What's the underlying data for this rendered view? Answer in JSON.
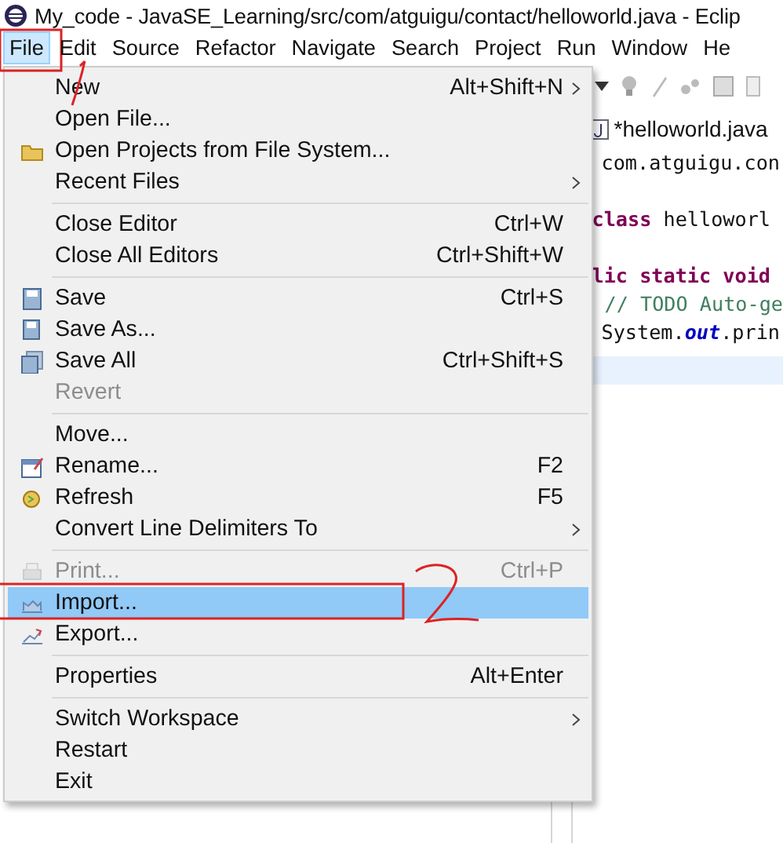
{
  "window": {
    "title": "My_code - JavaSE_Learning/src/com/atguigu/contact/helloworld.java - Eclip"
  },
  "menu_bar": [
    {
      "label": "File",
      "selected": true,
      "annotated": true
    },
    {
      "label": "Edit",
      "selected": false,
      "annotated": false
    },
    {
      "label": "Source",
      "selected": false,
      "annotated": false
    },
    {
      "label": "Refactor",
      "selected": false,
      "annotated": false
    },
    {
      "label": "Navigate",
      "selected": false,
      "annotated": false
    },
    {
      "label": "Search",
      "selected": false,
      "annotated": false
    },
    {
      "label": "Project",
      "selected": false,
      "annotated": false
    },
    {
      "label": "Run",
      "selected": false,
      "annotated": false
    },
    {
      "label": "Window",
      "selected": false,
      "annotated": false
    },
    {
      "label": "He",
      "selected": false,
      "annotated": false
    }
  ],
  "file_menu": [
    {
      "kind": "item",
      "label": "New",
      "shortcut": "Alt+Shift+N",
      "submenu": true,
      "disabled": false,
      "selected": false,
      "annotated": false
    },
    {
      "kind": "item",
      "label": "Open File...",
      "disabled": false,
      "selected": false,
      "annotated": false
    },
    {
      "kind": "item",
      "label": "Open Projects from File System...",
      "disabled": false,
      "selected": false,
      "annotated": false
    },
    {
      "kind": "item",
      "label": "Recent Files",
      "submenu": true,
      "disabled": false,
      "selected": false,
      "annotated": false
    },
    {
      "kind": "separator"
    },
    {
      "kind": "item",
      "label": "Close Editor",
      "shortcut": "Ctrl+W",
      "disabled": false,
      "selected": false,
      "annotated": false
    },
    {
      "kind": "item",
      "label": "Close All Editors",
      "shortcut": "Ctrl+Shift+W",
      "disabled": false,
      "selected": false,
      "annotated": false
    },
    {
      "kind": "separator"
    },
    {
      "kind": "item",
      "label": "Save",
      "shortcut": "Ctrl+S",
      "disabled": false,
      "selected": false,
      "annotated": false
    },
    {
      "kind": "item",
      "label": "Save As...",
      "disabled": false,
      "selected": false,
      "annotated": false
    },
    {
      "kind": "item",
      "label": "Save All",
      "shortcut": "Ctrl+Shift+S",
      "disabled": false,
      "selected": false,
      "annotated": false
    },
    {
      "kind": "item",
      "label": "Revert",
      "disabled": true,
      "selected": false,
      "annotated": false
    },
    {
      "kind": "separator"
    },
    {
      "kind": "item",
      "label": "Move...",
      "disabled": false,
      "selected": false,
      "annotated": false
    },
    {
      "kind": "item",
      "label": "Rename...",
      "shortcut": "F2",
      "disabled": false,
      "selected": false,
      "annotated": false
    },
    {
      "kind": "item",
      "label": "Refresh",
      "shortcut": "F5",
      "disabled": false,
      "selected": false,
      "annotated": false
    },
    {
      "kind": "item",
      "label": "Convert Line Delimiters To",
      "submenu": true,
      "disabled": false,
      "selected": false,
      "annotated": false
    },
    {
      "kind": "separator"
    },
    {
      "kind": "item",
      "label": "Print...",
      "shortcut": "Ctrl+P",
      "disabled": true,
      "selected": false,
      "annotated": false
    },
    {
      "kind": "item",
      "label": "Import...",
      "disabled": false,
      "selected": true,
      "annotated": true
    },
    {
      "kind": "item",
      "label": "Export...",
      "disabled": false,
      "selected": false,
      "annotated": false
    },
    {
      "kind": "separator"
    },
    {
      "kind": "item",
      "label": "Properties",
      "shortcut": "Alt+Enter",
      "disabled": false,
      "selected": false,
      "annotated": false
    },
    {
      "kind": "separator"
    },
    {
      "kind": "item",
      "label": "Switch Workspace",
      "submenu": true,
      "disabled": false,
      "selected": false,
      "annotated": false
    },
    {
      "kind": "item",
      "label": "Restart",
      "disabled": false,
      "selected": false,
      "annotated": false
    },
    {
      "kind": "item",
      "label": "Exit",
      "disabled": false,
      "selected": false,
      "annotated": false
    }
  ],
  "editor": {
    "tab": "*helloworld.java",
    "lines": [
      {
        "kind": "plain",
        "text": "com.atguigu.con"
      },
      {
        "kind": "blank"
      },
      {
        "kind": "decl",
        "keyword": "class",
        "text": " helloworl"
      },
      {
        "kind": "blank"
      },
      {
        "kind": "decl",
        "keyword": "lic static void"
      },
      {
        "kind": "comment",
        "text": "// TODO Auto-ge"
      },
      {
        "kind": "call",
        "before": "System.",
        "field": "out",
        "after": ".prin"
      },
      {
        "kind": "current"
      }
    ]
  }
}
